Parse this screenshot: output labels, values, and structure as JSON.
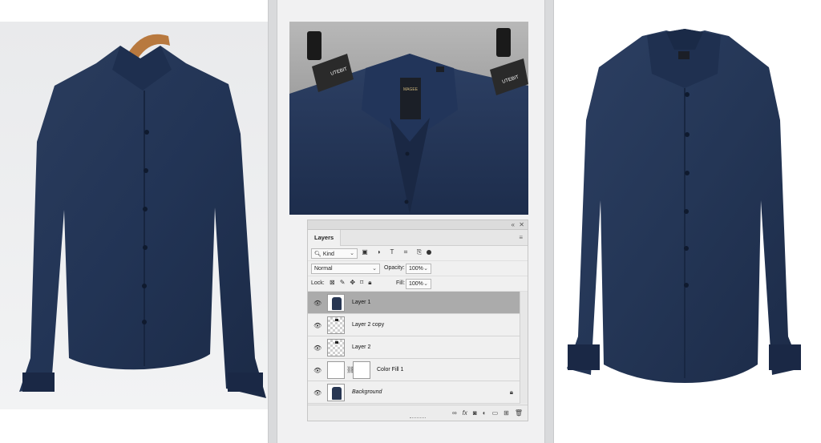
{
  "colors": {
    "shirt_navy": "#243655",
    "selected_layer": "#ababab",
    "panel_bg": "#f0f0f0"
  },
  "label_tag": {
    "brand": "MAGEE",
    "clip_text": "UTEBIT"
  },
  "layers_panel": {
    "panel_controls": [
      "«",
      "✕"
    ],
    "tab_label": "Layers",
    "menu_icon": "menu-icon",
    "filter": {
      "kind_value": "Kind",
      "search_icon": "search-icon",
      "icons": [
        "pixel-filter-icon",
        "adjustment-filter-icon",
        "type-filter-icon",
        "shape-filter-icon",
        "smart-object-filter-icon"
      ]
    },
    "blend_mode": "Normal",
    "opacity_label": "Opacity:",
    "opacity_value": "100%",
    "lock_label": "Lock:",
    "fill_label": "Fill:",
    "fill_value": "100%",
    "layers": [
      {
        "name": "Layer 1",
        "selected": true,
        "thumb": "shirt"
      },
      {
        "name": "Layer 2 copy",
        "selected": false,
        "thumb": "transparent"
      },
      {
        "name": "Layer 2",
        "selected": false,
        "thumb": "transparent"
      },
      {
        "name": "Color Fill 1",
        "selected": false,
        "thumb": "fill-with-mask"
      },
      {
        "name": "Background",
        "selected": false,
        "thumb": "shirt",
        "locked": true
      }
    ],
    "bottom_icons": [
      "link-layers-icon",
      "fx-icon",
      "add-mask-icon",
      "adjustment-layer-icon",
      "new-group-icon",
      "new-layer-icon",
      "delete-icon"
    ]
  }
}
